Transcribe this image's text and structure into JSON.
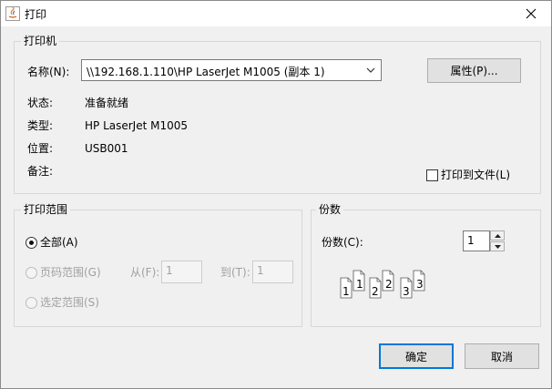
{
  "window": {
    "title": "打印",
    "close_icon": "close-icon"
  },
  "printer_group": {
    "title": "打印机",
    "name_label": "名称(N):",
    "name_value": "\\\\192.168.1.110\\HP LaserJet M1005 (副本 1)",
    "properties_button": "属性(P)...",
    "status_label": "状态:",
    "status_value": "准备就绪",
    "type_label": "类型:",
    "type_value": "HP LaserJet M1005",
    "location_label": "位置:",
    "location_value": "USB001",
    "comment_label": "备注:",
    "print_to_file_label": "打印到文件(L)",
    "print_to_file_checked": false
  },
  "range_group": {
    "title": "打印范围",
    "all_label": "全部(A)",
    "all_selected": true,
    "pages_label": "页码范围(G)",
    "from_label": "从(F):",
    "from_value": "1",
    "to_label": "到(T):",
    "to_value": "1",
    "selection_label": "选定范围(S)"
  },
  "copies_group": {
    "title": "份数",
    "copies_label": "份数(C):",
    "copies_value": "1",
    "collate_pages": [
      "1",
      "1",
      "2",
      "2",
      "3",
      "3"
    ]
  },
  "buttons": {
    "ok": "确定",
    "cancel": "取消"
  },
  "colors": {
    "accent": "#0078d7",
    "disabled_text": "#a0a0a0"
  }
}
